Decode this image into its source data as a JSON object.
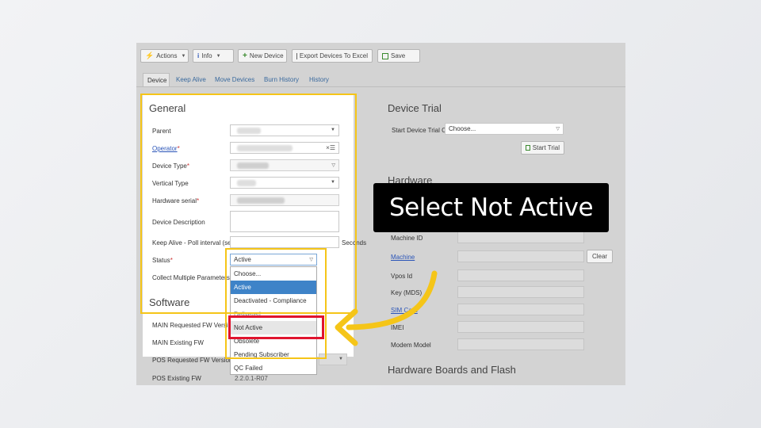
{
  "toolbar": {
    "actions": "Actions",
    "info": "Info",
    "new_device": "New Device",
    "export": "Export Devices To Excel",
    "save": "Save"
  },
  "tabs": [
    "Device",
    "Keep Alive",
    "Move Devices",
    "Burn History",
    "History"
  ],
  "general": {
    "title": "General",
    "parent_label": "Parent",
    "operator_label": "Operator",
    "device_type_label": "Device Type",
    "vertical_type_label": "Vertical Type",
    "hardware_serial_label": "Hardware serial",
    "device_description_label": "Device Description",
    "keep_alive_label": "Keep Alive - Poll interval (sec)",
    "keep_alive_unit": "Seconds",
    "status_label": "Status",
    "collect_label": "Collect Multiple Parameters",
    "required_mark": "*",
    "clear_icon_text": "×☰"
  },
  "status": {
    "value": "Active",
    "options": [
      "Choose...",
      "Active",
      "Deactivated - Compliance",
      "Delivered",
      "Not Active",
      "Obsolete",
      "Pending Subscriber",
      "QC Failed"
    ]
  },
  "software": {
    "title": "Software",
    "main_requested_label": "MAIN Requested FW Version",
    "main_existing_label": "MAIN Existing FW",
    "pos_requested_label": "POS Requested FW Version",
    "pos_existing_label": "POS Existing FW",
    "pos_existing_value": "2.2.0.1-R07"
  },
  "device_trial": {
    "title": "Device Trial",
    "start_label": "Start Device Trial Of",
    "start_value": "Choose...",
    "start_button": "Start Trial"
  },
  "hardware": {
    "title": "Hardware",
    "machine_id_label": "Machine ID",
    "machine_label": "Machine",
    "clear_button": "Clear",
    "vpos_label": "Vpos Id",
    "key_label": "Key (MDS)",
    "sim_label": "SIM Card",
    "imei_label": "IMEI",
    "modem_label": "Modem Model"
  },
  "boards": {
    "title": "Hardware Boards and Flash"
  },
  "callout": {
    "text": "Select Not Active"
  },
  "colors": {
    "highlight": "#f5c518",
    "target": "#e0142e",
    "selected_option": "#3e83c8",
    "link": "#2b55b8"
  }
}
